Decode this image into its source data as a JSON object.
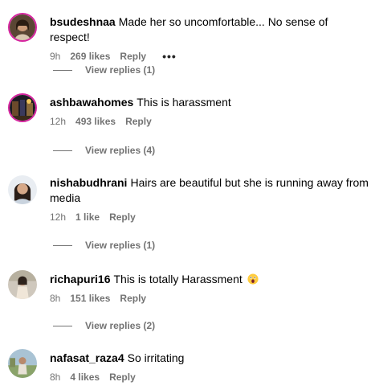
{
  "colors": {
    "text": "#000000",
    "secondary": "#737373",
    "story_ring": "#d6249f"
  },
  "comments": [
    {
      "username": "bsudeshnaa",
      "text": "Made her so uncomfortable... No sense of respect!",
      "time": "9h",
      "likes": "269 likes",
      "reply": "Reply",
      "more_icon": "more-horizontal-icon",
      "view_replies": "View replies (1)"
    },
    {
      "username": "ashbawahomes",
      "text": "This is harassment",
      "time": "12h",
      "likes": "493 likes",
      "reply": "Reply",
      "view_replies": "View replies (4)"
    },
    {
      "username": "nishabudhrani",
      "text": "Hairs are beautiful but she is running away from media",
      "time": "12h",
      "likes": "1 like",
      "reply": "Reply",
      "view_replies": "View replies (1)"
    },
    {
      "username": "richapuri16",
      "text": "This is totally Harassment",
      "emoji": "astonished-face-emoji",
      "time": "8h",
      "likes": "151 likes",
      "reply": "Reply",
      "view_replies": "View replies (2)"
    },
    {
      "username": "nafasat_raza4",
      "text": "So irritating",
      "time": "8h",
      "likes": "4 likes",
      "reply": "Reply"
    }
  ]
}
